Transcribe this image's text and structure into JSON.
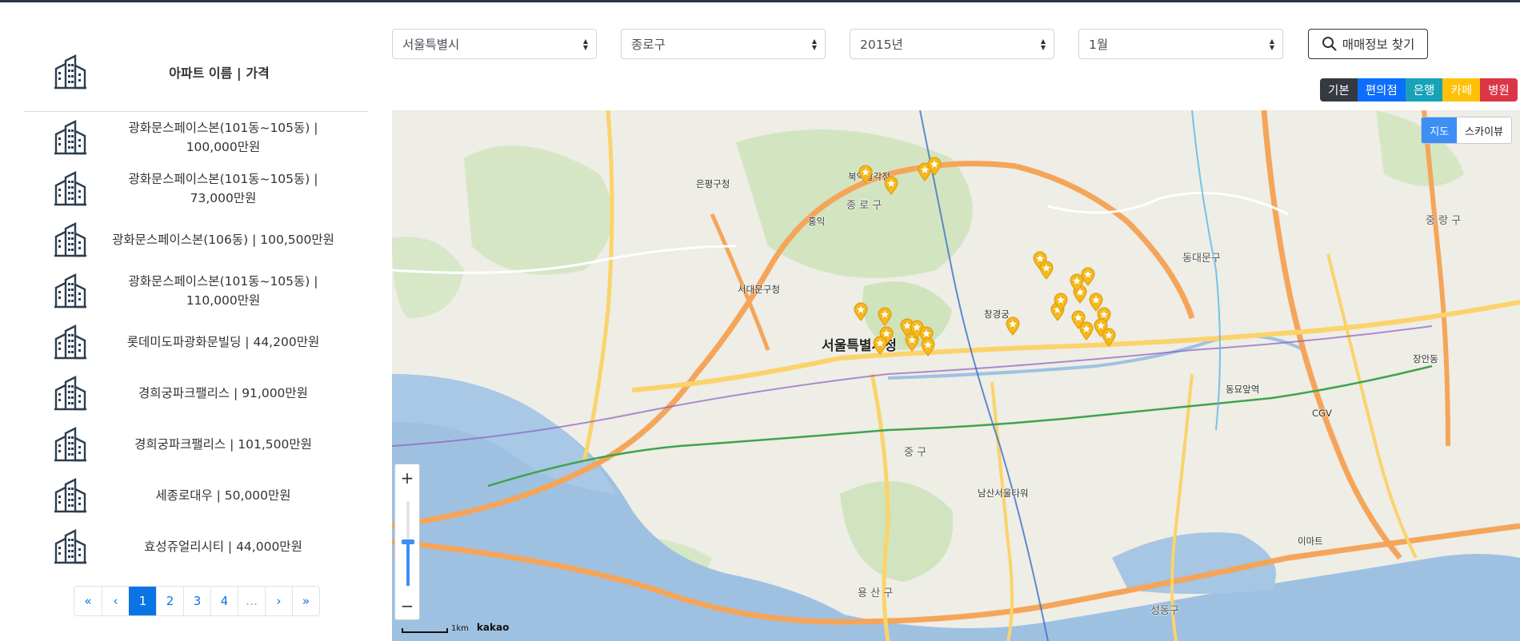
{
  "filters": {
    "city": "서울특별시",
    "district": "종로구",
    "year": "2015년",
    "month": "1월",
    "search_label": "매매정보 찾기"
  },
  "categories": [
    {
      "label": "기본",
      "color": "#343a40"
    },
    {
      "label": "편의점",
      "color": "#0d6efd"
    },
    {
      "label": "은행",
      "color": "#17a2b8"
    },
    {
      "label": "카페",
      "color": "#ffc107"
    },
    {
      "label": "병원",
      "color": "#dc3545"
    }
  ],
  "list": {
    "header": "아파트 이름 | 가격",
    "items": [
      {
        "line1": "광화문스페이스본(101동~105동) |",
        "line2": "100,000만원"
      },
      {
        "line1": "광화문스페이스본(101동~105동) |",
        "line2": "73,000만원"
      },
      {
        "line1": "광화문스페이스본(106동) | 100,500만원",
        "line2": ""
      },
      {
        "line1": "광화문스페이스본(101동~105동) |",
        "line2": "110,000만원"
      },
      {
        "line1": "롯데미도파광화문빌딩 | 44,200만원",
        "line2": ""
      },
      {
        "line1": "경희궁파크팰리스 | 91,000만원",
        "line2": ""
      },
      {
        "line1": "경희궁파크팰리스 | 101,500만원",
        "line2": ""
      },
      {
        "line1": "세종로대우 | 50,000만원",
        "line2": ""
      },
      {
        "line1": "효성쥬얼리시티 | 44,000만원",
        "line2": ""
      }
    ]
  },
  "pagination": {
    "first": "«",
    "prev": "‹",
    "pages": [
      "1",
      "2",
      "3",
      "4"
    ],
    "ellipsis": "…",
    "next": "›",
    "last": "»",
    "current": "1"
  },
  "map": {
    "type_map": "지도",
    "type_sky": "스카이뷰",
    "zoom_in": "+",
    "zoom_out": "−",
    "scale": "1km",
    "brand": "kakao",
    "labels": {
      "seoul_city_hall": "서울특별시청",
      "jongno": "종 로 구",
      "jung": "중 구",
      "yongsan": "용 산 구",
      "seongdong": "성동구",
      "dongdaemun": "동대문구",
      "jungnang": "중 랑 구",
      "seodaemun_office": "서대문구청",
      "eunpyeong_office": "은평구청",
      "bukaksan": "북악팔각정",
      "changgyeonggung": "창경궁",
      "hongik": "홍익",
      "dongdaemun_station": "동묘앞역",
      "cgv": "CGV",
      "e_mart": "이마트",
      "namsan": "남산서울타워",
      "jangan": "장안동"
    }
  }
}
